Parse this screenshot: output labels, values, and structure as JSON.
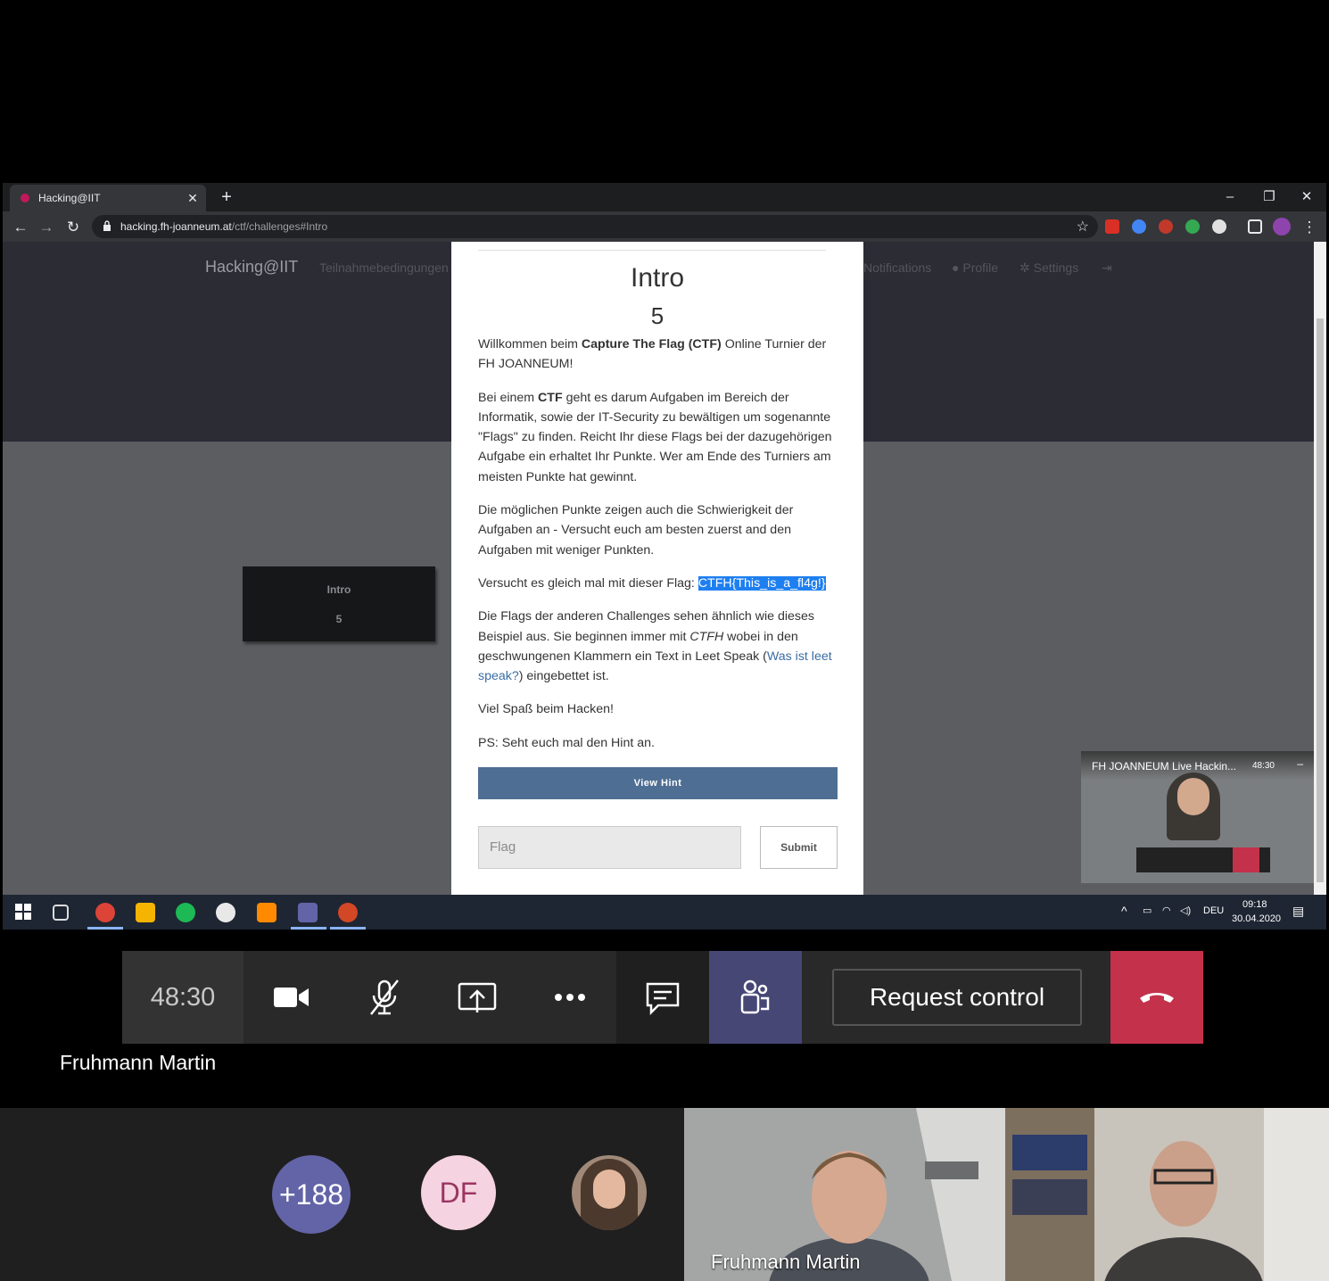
{
  "browser": {
    "tab_title": "Hacking@IIT",
    "url_host": "hacking.fh-joanneum.at",
    "url_path": "/ctf/challenges#Intro"
  },
  "site": {
    "brand": "Hacking@IIT",
    "nav_left": "Teilnahmebedingungen",
    "nav_notifications": "Notifications",
    "nav_profile": "Profile",
    "nav_settings": "Settings"
  },
  "challenge_card": {
    "name": "Intro",
    "value": "5"
  },
  "modal": {
    "title": "Intro",
    "value": "5",
    "p1_pre": "Willkommen beim ",
    "p1_bold": "Capture The Flag (CTF)",
    "p1_post": " Online Turnier der FH JOANNEUM!",
    "p2_pre": "Bei einem ",
    "p2_bold": "CTF",
    "p2_post": " geht es darum Aufgaben im Bereich der Informatik, sowie der IT-Security zu bewältigen um sogenannte \"Flags\" zu finden. Reicht Ihr diese Flags bei der dazugehörigen Aufgabe ein erhaltet Ihr Punkte. Wer am Ende des Turniers am meisten Punkte hat gewinnt.",
    "p3": "Die möglichen Punkte zeigen auch die Schwierigkeit der Aufgaben an - Versucht euch am besten zuerst and den Aufgaben mit weniger Punkten.",
    "p4_pre": "Versucht es gleich mal mit dieser Flag: ",
    "p4_flag": "CTFH{This_is_a_fl4g!}",
    "p5_pre": "Die Flags der anderen Challenges sehen ähnlich wie dieses Beispiel aus. Sie beginnen immer mit ",
    "p5_em": "CTFH",
    "p5_mid": " wobei in den geschwungenen Klammern ein Text in Leet Speak (",
    "p5_link": "Was ist leet speak?",
    "p5_post": ") eingebettet ist.",
    "p6": "Viel Spaß beim Hacken!",
    "p7": "PS: Seht euch mal den Hint an.",
    "hint_button": "View Hint",
    "flag_placeholder": "Flag",
    "submit_button": "Submit"
  },
  "mini_call": {
    "title": "FH JOANNEUM Live Hackin...",
    "time": "48:30",
    "minimize": "–"
  },
  "taskbar": {
    "lang": "DEU",
    "time": "09:18",
    "date": "30.04.2020"
  },
  "teams": {
    "timer": "48:30",
    "request_control": "Request control",
    "presenter_name": "Fruhmann Martin"
  },
  "participants": {
    "overflow_count": "+188",
    "df_initials": "DF",
    "video1_name": "Fruhmann Martin"
  },
  "colors": {
    "hint_button": "#4f6e93",
    "flag_highlight": "#1e7ff0",
    "hangup": "#c4314b",
    "teams_active": "#464775",
    "overflow_avatar": "#6264a7"
  }
}
